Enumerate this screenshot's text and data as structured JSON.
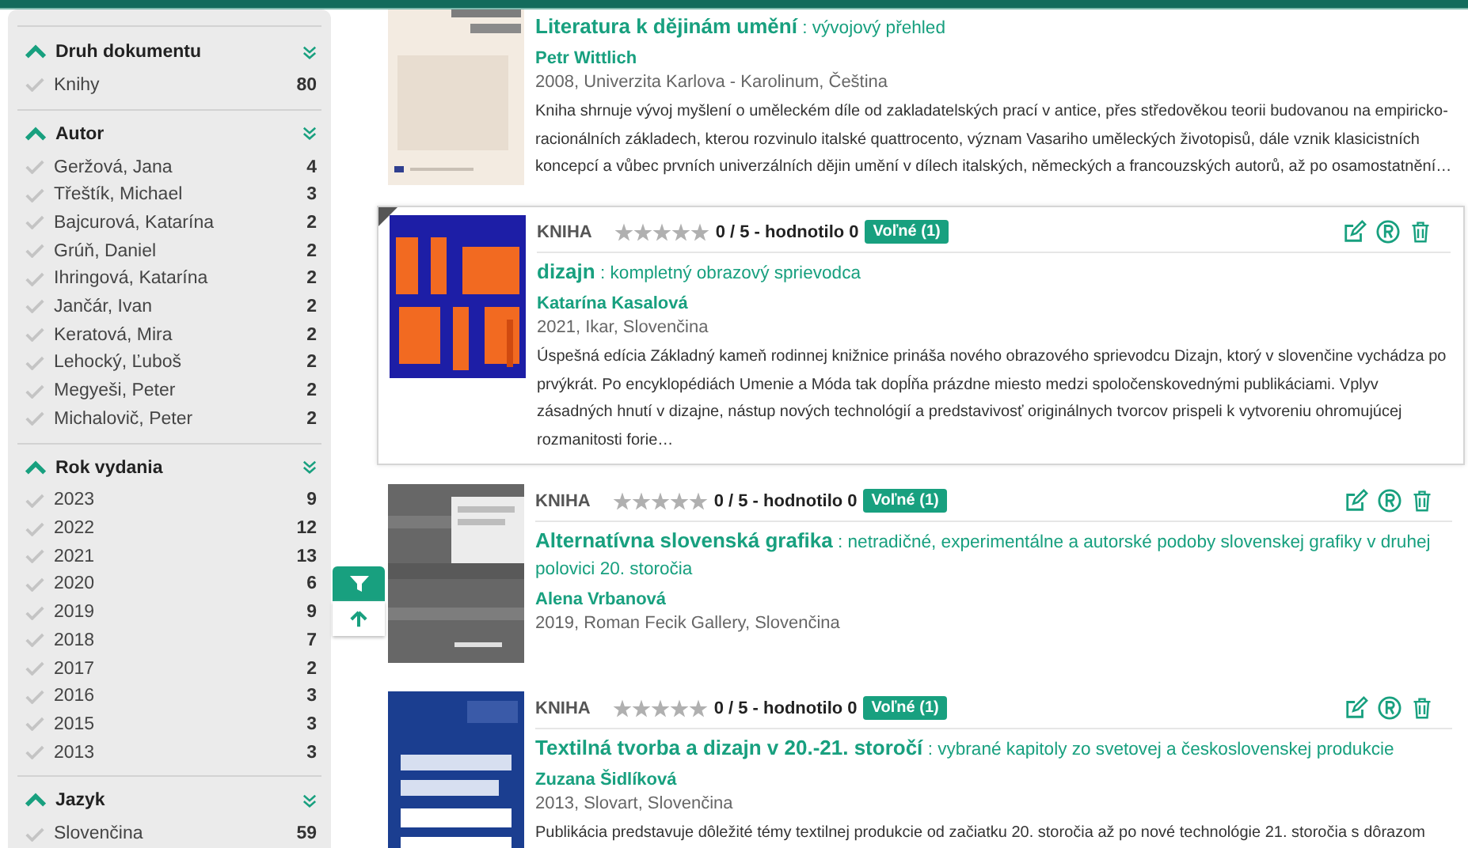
{
  "sidebar": {
    "sections": [
      {
        "title": "Druh dokumentu",
        "expanded": true,
        "items": [
          {
            "label": "Knihy",
            "count": "80",
            "checked": false
          }
        ]
      },
      {
        "title": "Autor",
        "expanded": true,
        "items": [
          {
            "label": "Geržová, Jana",
            "count": "4",
            "checked": false
          },
          {
            "label": "Třeštík, Michael",
            "count": "3",
            "checked": false
          },
          {
            "label": "Bajcurová, Katarína",
            "count": "2",
            "checked": false
          },
          {
            "label": "Grúň, Daniel",
            "count": "2",
            "checked": false
          },
          {
            "label": "Ihringová, Katarína",
            "count": "2",
            "checked": false
          },
          {
            "label": "Jančár, Ivan",
            "count": "2",
            "checked": false
          },
          {
            "label": "Keratová, Mira",
            "count": "2",
            "checked": false
          },
          {
            "label": "Lehocký, Ľuboš",
            "count": "2",
            "checked": false
          },
          {
            "label": "Megyeši, Peter",
            "count": "2",
            "checked": false
          },
          {
            "label": "Michalovič, Peter",
            "count": "2",
            "checked": false
          }
        ]
      },
      {
        "title": "Rok vydania",
        "expanded": true,
        "items": [
          {
            "label": "2023",
            "count": "9",
            "checked": false
          },
          {
            "label": "2022",
            "count": "12",
            "checked": false
          },
          {
            "label": "2021",
            "count": "13",
            "checked": false
          },
          {
            "label": "2020",
            "count": "6",
            "checked": false
          },
          {
            "label": "2019",
            "count": "9",
            "checked": false
          },
          {
            "label": "2018",
            "count": "7",
            "checked": false
          },
          {
            "label": "2017",
            "count": "2",
            "checked": false
          },
          {
            "label": "2016",
            "count": "3",
            "checked": false
          },
          {
            "label": "2015",
            "count": "3",
            "checked": false
          },
          {
            "label": "2013",
            "count": "3",
            "checked": false
          }
        ]
      },
      {
        "title": "Jazyk",
        "expanded": true,
        "items": [
          {
            "label": "Slovenčina",
            "count": "59",
            "checked": false
          }
        ]
      }
    ]
  },
  "records": [
    {
      "highlighted": false,
      "title": "Literatura k dějinám umění",
      "subtitle": ": vývojový přehled",
      "author": "Petr Wittlich",
      "meta": "2008, Univerzita Karlova - Karolinum, Čeština",
      "description": "Kniha shrnuje vývoj myšlení o uměleckém díle od zakladatelských prací v antice, přes středověkou teorii budovanou na empiricko-racionálních základech, kterou rozvinulo italské quattrocento, význam Vasariho uměleckých životopisů, dále vznik klasicistních koncepcí a vůbec prvních univerzálních dějin umění v dílech italských, německých a francouzských autorů, až po osamostatnění…"
    },
    {
      "highlighted": true,
      "header": {
        "type": "KNIHA",
        "stars": 0,
        "rating": "0 / 5 - hodnotilo 0",
        "availability": "Voľné (1)"
      },
      "title": "dizajn",
      "subtitle": ": kompletný obrazový sprievodca",
      "author": "Katarína Kasalová",
      "meta": "2021, Ikar, Slovenčina",
      "description": "Úspešná edícia Základný kameň rodinnej knižnice prináša nového obrazového sprievodcu Dizajn, ktorý v slovenčine vychádza po prvýkrát. Po encyklopédiách Umenie a Móda tak dopĺňa prázdne miesto medzi spoločenskovednými publikáciami. Vplyv zásadných hnutí v dizajne, nástup nových technológií a predstavivosť originálnych tvorcov prispeli k vytvoreniu ohromujúcej rozmanitosti forie…"
    },
    {
      "highlighted": false,
      "header": {
        "type": "KNIHA",
        "stars": 0,
        "rating": "0 / 5 - hodnotilo 0",
        "availability": "Voľné (1)"
      },
      "title": "Alternatívna slovenská grafika",
      "subtitle": ": netradičné, experimentálne a autorské podoby slovenskej grafiky v druhej polovici 20. storočia",
      "author": "Alena Vrbanová",
      "meta": "2019, Roman Fecik Gallery, Slovenčina"
    },
    {
      "highlighted": false,
      "header": {
        "type": "KNIHA",
        "stars": 0,
        "rating": "0 / 5 - hodnotilo 0",
        "availability": "Voľné (1)"
      },
      "title": "Textilná tvorba a dizajn v 20.-21. storočí",
      "subtitle": ": vybrané kapitoly zo svetovej a československej produkcie",
      "author": "Zuzana Šidlíková",
      "meta": "2013, Slovart, Slovenčina",
      "description": "Publikácia predstavuje dôležité témy textilnej produkcie od začiatku 20. storočia až po nové technológie 21. storočia s dôrazom"
    }
  ]
}
